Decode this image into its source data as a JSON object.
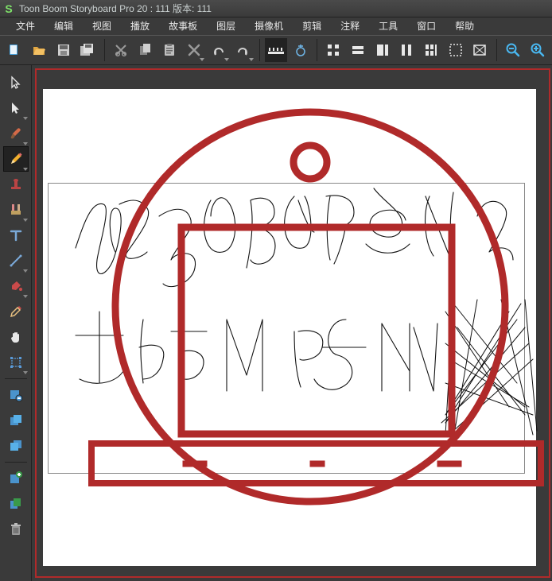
{
  "titlebar": {
    "app_icon": "S",
    "title": "Toon Boom Storyboard Pro 20 : 111 版本: 111"
  },
  "menus": {
    "file": "文件",
    "edit": "编辑",
    "view": "视图",
    "play": "播放",
    "storyboard": "故事板",
    "layer": "图层",
    "camera": "摄像机",
    "clip": "剪辑",
    "caption": "注释",
    "tools": "工具",
    "window": "窗口",
    "help": "帮助"
  },
  "toolbar_names": {
    "new": "new",
    "open": "open",
    "save": "save",
    "saveall": "save-all",
    "cut": "cut",
    "copy": "copy",
    "paste": "paste",
    "delete": "delete",
    "undo": "undo",
    "redo": "redo",
    "timeline": "timeline",
    "onion": "onion-skin",
    "grid4": "grid",
    "gridh": "panel-grid",
    "panelr": "panel-right",
    "panelc": "panel-column",
    "panelm": "panel-multi",
    "overlay": "overlay",
    "safe": "safe-area",
    "zoomout": "zoom-out",
    "zoomin": "zoom-in"
  },
  "side_names": {
    "pointer": "pointer",
    "select": "select",
    "brush": "brush",
    "pencil": "pencil",
    "stamp": "stamp",
    "eraser": "eraser",
    "text": "text",
    "line": "line",
    "bucket": "bucket",
    "dropper": "dropper",
    "hand": "hand",
    "transform": "transform",
    "layerprops": "layer-props",
    "layerfront": "layer-to-front",
    "layerback": "layer-to-back",
    "addlayer": "add-layer",
    "dupelayer": "duplicate-layer",
    "trash": "trash"
  }
}
